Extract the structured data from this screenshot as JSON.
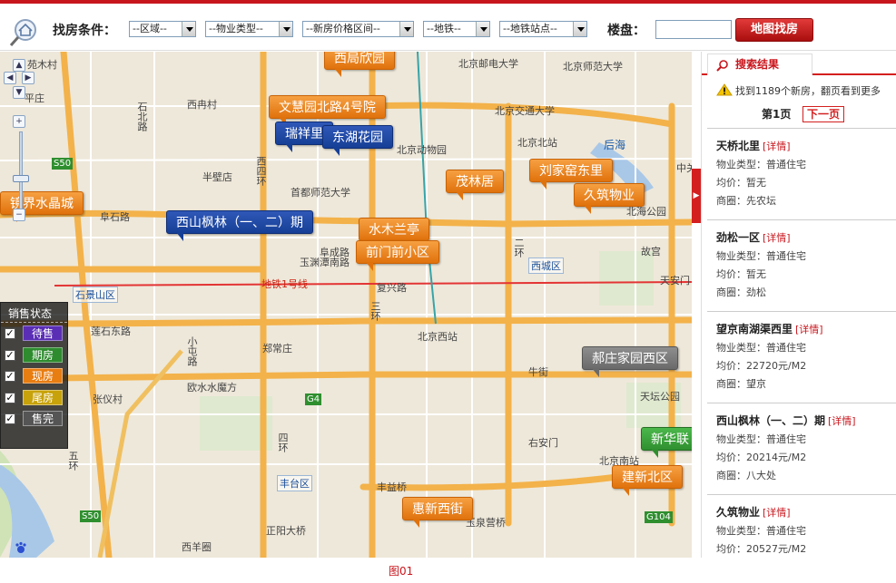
{
  "toolbar": {
    "filter_title": "找房条件：",
    "selects": [
      "--区域--",
      "--物业类型--",
      "--新房价格区间--",
      "--地铁--",
      "--地铁站点--"
    ],
    "loupan_label": "楼盘：",
    "loupan_value": "",
    "map_search_label": "地图找房"
  },
  "map": {
    "markers": [
      {
        "label": "西局欣园",
        "color": "orange"
      },
      {
        "label": "文慧园北路4号院",
        "color": "orange"
      },
      {
        "label": "瑞祥里",
        "color": "blue"
      },
      {
        "label": "东湖花园",
        "color": "blue"
      },
      {
        "label": "镜界水晶城",
        "color": "orange"
      },
      {
        "label": "西山枫林（一、二）期",
        "color": "blue"
      },
      {
        "label": "茂林居",
        "color": "orange"
      },
      {
        "label": "刘家窑东里",
        "color": "orange"
      },
      {
        "label": "久筑物业",
        "color": "orange"
      },
      {
        "label": "水木兰亭",
        "color": "orange"
      },
      {
        "label": "前门前小区",
        "color": "orange"
      },
      {
        "label": "郝庄家园西区",
        "color": "gray"
      },
      {
        "label": "新华联",
        "color": "green"
      },
      {
        "label": "建新北区",
        "color": "orange"
      },
      {
        "label": "惠新西街",
        "color": "orange"
      }
    ],
    "places": [
      "北京邮电大学",
      "北京师范大学",
      "北京交通大学",
      "北京北站",
      "北京动物园",
      "首都师范大学",
      "中关",
      "北海公园",
      "故宫",
      "天安门",
      "北京西站",
      "牛街",
      "天坛公园",
      "右安门",
      "北京南站",
      "郑常庄",
      "欧水水魔方",
      "丰益桥",
      "玉泉营桥",
      "正阳大桥",
      "西羊圈",
      "半壁店",
      "西四环",
      "西冉村",
      "平庄",
      "苑木村",
      "石北路",
      "阜石路",
      "玉渊潭南路",
      "复兴路",
      "莲石东路",
      "小屯路",
      "张仪村",
      "二环",
      "三环",
      "四环",
      "五环",
      "阜成路",
      "后海",
      "地铁1号线"
    ],
    "districts": [
      "石景山区",
      "西城区",
      "丰台区"
    ],
    "road_tags": [
      "S50",
      "G4",
      "G104",
      "S50"
    ]
  },
  "legend": {
    "title": "销售状态",
    "items": [
      {
        "label": "待售",
        "color": "#5b2fb5",
        "checked": true
      },
      {
        "label": "期房",
        "color": "#2e8b2e",
        "checked": true
      },
      {
        "label": "现房",
        "color": "#e87d12",
        "checked": true
      },
      {
        "label": "尾房",
        "color": "#c7a20a",
        "checked": true
      },
      {
        "label": "售完",
        "color": "#555555",
        "checked": true
      }
    ]
  },
  "panel": {
    "tab_label": "搜索结果",
    "notice": "找到1189个新房，翻页看到更多",
    "page_label": "第1页",
    "next_label": "下一页",
    "results": [
      {
        "name": "天桥北里",
        "detail": "[详情]",
        "type": "物业类型：普通住宅",
        "price": "均价：暂无",
        "area": "商圈：先农坛"
      },
      {
        "name": "劲松一区",
        "detail": "[详情]",
        "type": "物业类型：普通住宅",
        "price": "均价：暂无",
        "area": "商圈：劲松"
      },
      {
        "name": "望京南湖渠西里",
        "detail": "[详情]",
        "type": "物业类型：普通住宅",
        "price": "均价：22720元/M2",
        "area": "商圈：望京"
      },
      {
        "name": "西山枫林（一、二）期",
        "detail": "[详情]",
        "type": "物业类型：普通住宅",
        "price": "均价：20214元/M2",
        "area": "商圈：八大处"
      },
      {
        "name": "久筑物业",
        "detail": "[详情]",
        "type": "物业类型：普通住宅",
        "price": "均价：20527元/M2",
        "area": ""
      }
    ]
  },
  "caption": "图01"
}
